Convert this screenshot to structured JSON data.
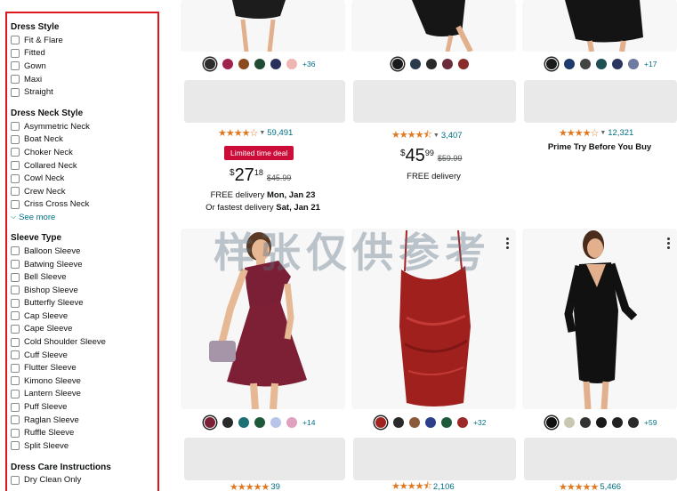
{
  "sidebar": {
    "dress_style": {
      "title": "Dress Style",
      "options": [
        "Fit & Flare",
        "Fitted",
        "Gown",
        "Maxi",
        "Straight"
      ]
    },
    "neck_style": {
      "title": "Dress Neck Style",
      "options": [
        "Asymmetric Neck",
        "Boat Neck",
        "Choker Neck",
        "Collared Neck",
        "Cowl Neck",
        "Crew Neck",
        "Criss Cross Neck"
      ],
      "see_more": "See more"
    },
    "sleeve_type": {
      "title": "Sleeve Type",
      "options": [
        "Balloon Sleeve",
        "Batwing Sleeve",
        "Bell Sleeve",
        "Bishop Sleeve",
        "Butterfly Sleeve",
        "Cap Sleeve",
        "Cape Sleeve",
        "Cold Shoulder Sleeve",
        "Cuff Sleeve",
        "Flutter Sleeve",
        "Kimono Sleeve",
        "Lantern Sleeve",
        "Puff Sleeve",
        "Raglan Sleeve",
        "Ruffle Sleeve",
        "Split Sleeve"
      ]
    },
    "care": {
      "title": "Dress Care Instructions",
      "options": [
        "Dry Clean Only"
      ]
    }
  },
  "products": {
    "r1c1": {
      "swatches": [
        "#2d2d2d",
        "#a0234a",
        "#8a4a1e",
        "#1f4b34",
        "#2b2f5c",
        "#f0b6b1"
      ],
      "more": "+36",
      "rating": 4.0,
      "count": "59,491",
      "deal": "Limited time deal",
      "price_currency": "$",
      "price_whole": "27",
      "price_frac": "18",
      "list_price": "$45.99",
      "delivery_1_prefix": "FREE delivery ",
      "delivery_1_date": "Mon, Jan 23",
      "delivery_2_prefix": "Or fastest delivery ",
      "delivery_2_date": "Sat, Jan 21"
    },
    "r1c2": {
      "swatches": [
        "#1a1a1a",
        "#2b3a4a",
        "#2a2a2a",
        "#6b2a3a",
        "#8a2a2a"
      ],
      "rating": 4.5,
      "count": "3,407",
      "price_currency": "$",
      "price_whole": "45",
      "price_frac": "99",
      "list_price": "$59.99",
      "delivery_1_prefix": "FREE delivery"
    },
    "r1c3": {
      "swatches": [
        "#1a1a1a",
        "#1f3b6b",
        "#444444",
        "#1e4f52",
        "#2c3560",
        "#6e7aa0"
      ],
      "more": "+17",
      "rating": 4.0,
      "count": "12,321",
      "prime_text": "Prime Try Before You Buy"
    },
    "r2c1": {
      "swatches": [
        "#7a1f35",
        "#2a2a2a",
        "#1c6f73",
        "#1e5a3a",
        "#b8c4e8",
        "#e0a0c0"
      ],
      "more": "+14",
      "rating_count": "39"
    },
    "r2c2": {
      "swatches": [
        "#a0231f",
        "#2a2a2a",
        "#8a5a3a",
        "#2b3f8a",
        "#1e5a3a",
        "#9a2a2a"
      ],
      "more": "+32",
      "rating_count": "2,106"
    },
    "r2c3": {
      "swatches": [
        "#111111",
        "#c8c8b0",
        "#333333",
        "#1a1a1a",
        "#222222",
        "#2a2a2a"
      ],
      "more": "+59",
      "rating_count": "5,466"
    }
  },
  "watermark": "样张仅供参考",
  "icons": {
    "checkbox": "checkbox-icon",
    "chevron": "chevron-down-icon",
    "star": "star-icon",
    "more": "more-options-icon"
  },
  "colors": {
    "accent_link": "#007185",
    "star": "#de7921",
    "deal": "#cc0c39",
    "highlight_border": "#e0161b"
  }
}
